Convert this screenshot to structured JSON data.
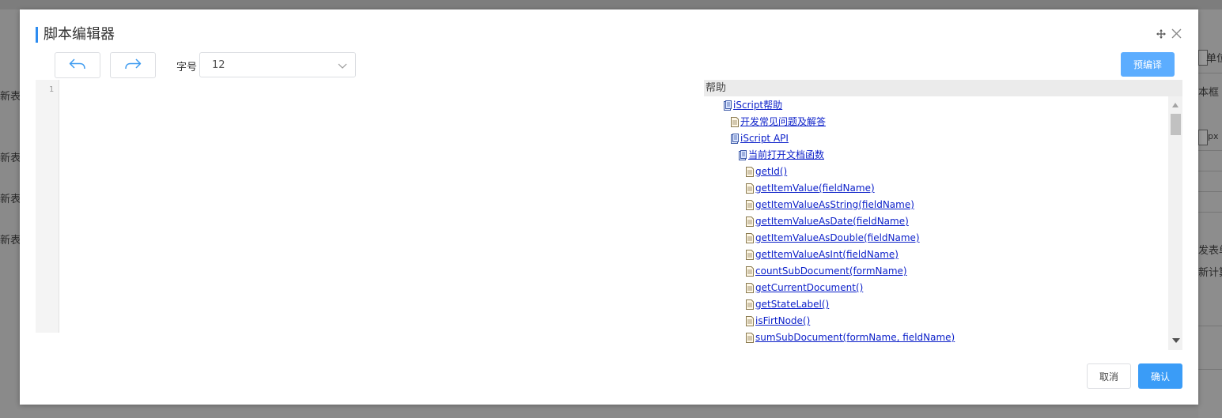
{
  "background": {
    "left_texts": [
      "新表",
      "新表",
      "新表",
      "新表"
    ],
    "right_texts": [
      "单位",
      "本框",
      "px",
      "发表单",
      "新计算"
    ]
  },
  "modal": {
    "title": "脚本编辑器",
    "font_size_label": "字号",
    "font_size_value": "12",
    "precompile_label": "预编译",
    "line_number": "1",
    "help_title": "帮助",
    "help_items": [
      {
        "label": "iScript帮助",
        "icon": "book-icon"
      },
      {
        "label": "开发常见问题及解答",
        "icon": "document-icon"
      },
      {
        "label": "iScript API",
        "icon": "book-icon"
      },
      {
        "label": "当前打开文档函数",
        "icon": "book-icon"
      },
      {
        "label": "getId()",
        "icon": "document-icon"
      },
      {
        "label": "getItemValue(fieldName)",
        "icon": "document-icon"
      },
      {
        "label": "getItemValueAsString(fieldName)",
        "icon": "document-icon"
      },
      {
        "label": "getItemValueAsDate(fieldName)",
        "icon": "document-icon"
      },
      {
        "label": "getItemValueAsDouble(fieldName)",
        "icon": "document-icon"
      },
      {
        "label": "getItemValueAsInt(fieldName)",
        "icon": "document-icon"
      },
      {
        "label": "countSubDocument(formName)",
        "icon": "document-icon"
      },
      {
        "label": "getCurrentDocument()",
        "icon": "document-icon"
      },
      {
        "label": "getStateLabel()",
        "icon": "document-icon"
      },
      {
        "label": "isFirtNode()",
        "icon": "document-icon"
      },
      {
        "label": "sumSubDocument(formName, fieldName)",
        "icon": "document-icon"
      }
    ],
    "cancel_label": "取消",
    "confirm_label": "确认"
  },
  "colors": {
    "accent": "#2d8cf0",
    "primary_button": "#3a9cf7",
    "precompile_button": "#5cadff",
    "link": "#0b1fc9"
  }
}
